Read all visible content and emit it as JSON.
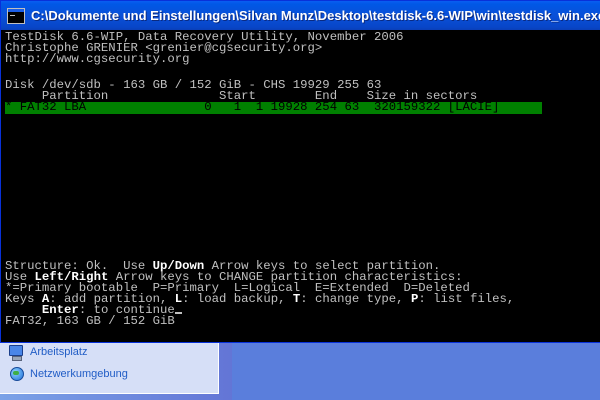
{
  "window": {
    "title": "C:\\Dokumente und Einstellungen\\Silvan Munz\\Desktop\\testdisk-6.6-WIP\\win\\testdisk_win.exe"
  },
  "console": {
    "header_line1": "TestDisk 6.6-WIP, Data Recovery Utility, November 2006",
    "header_line2": "Christophe GRENIER <grenier@cgsecurity.org>",
    "header_line3": "http://www.cgsecurity.org",
    "disk_line": "Disk /dev/sdb - 163 GB / 152 GiB - CHS 19929 255 63",
    "column_header": "     Partition               Start        End    Size in sectors",
    "partition_row": "* FAT32 LBA                0   1  1 19928 254 63  320159322 [LACIE]",
    "structure_prefix": "Structure: Ok.  Use ",
    "structure_key": "Up/Down",
    "structure_suffix": " Arrow keys to select partition.",
    "use_prefix": "Use ",
    "use_key": "Left/Right",
    "use_suffix": " Arrow keys to CHANGE partition characteristics:",
    "legend_line": "*=Primary bootable  P=Primary  L=Logical  E=Extended  D=Deleted",
    "keys_prefix": "Keys ",
    "keys_a": "A",
    "keys_a_text": ": add partition, ",
    "keys_l": "L",
    "keys_l_text": ": load backup, ",
    "keys_t": "T",
    "keys_t_text": ": change type, ",
    "keys_p": "P",
    "keys_p_text": ": list files,",
    "enter_indent": "     ",
    "enter_key": "Enter",
    "enter_text": ": to continue",
    "status_line": "FAT32, 163 GB / 152 GiB"
  },
  "explorer": {
    "items": [
      {
        "label": "Arbeitsplatz",
        "icon": "computer-icon"
      },
      {
        "label": "Netzwerkumgebung",
        "icon": "network-icon"
      }
    ]
  },
  "colors": {
    "console_bg": "#000000",
    "console_text": "#c0c0c0",
    "selection_bg": "#008000",
    "titlebar": "#0a50d8"
  }
}
